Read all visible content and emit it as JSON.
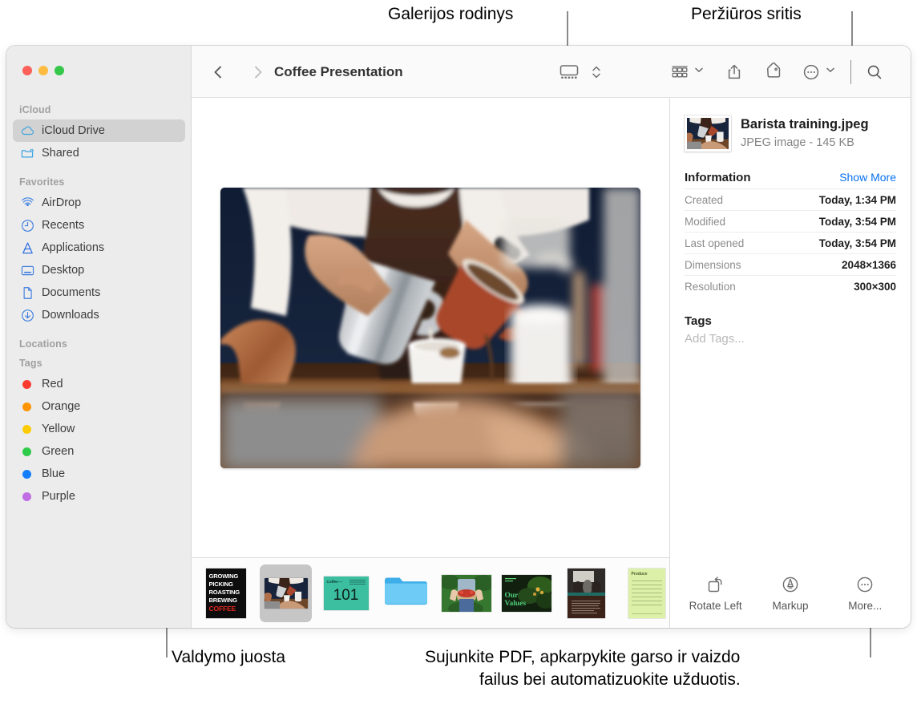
{
  "callouts": [
    {
      "id": "gallery-view",
      "text": "Galerijos rodinys"
    },
    {
      "id": "preview-pane",
      "text": "Peržiūros sritis"
    },
    {
      "id": "control-bar",
      "text": "Valdymo juosta"
    },
    {
      "id": "pdf-tasks-line1",
      "text": "Sujunkite PDF, apkarpykite garso ir vaizdo"
    },
    {
      "id": "pdf-tasks-line2",
      "text": "failus bei automatizuokite užduotis."
    }
  ],
  "window": {
    "traffic_lights": [
      {
        "name": "close",
        "color": "#fc6058"
      },
      {
        "name": "minimize",
        "color": "#fdbc40"
      },
      {
        "name": "zoom",
        "color": "#34c749"
      }
    ]
  },
  "sidebar": {
    "groups": [
      {
        "header": "iCloud",
        "items": [
          {
            "label": "iCloud Drive",
            "icon": "cloud-icon",
            "selected": true
          },
          {
            "label": "Shared",
            "icon": "shared-folder-icon",
            "selected": false
          }
        ]
      },
      {
        "header": "Favorites",
        "items": [
          {
            "label": "AirDrop",
            "icon": "airdrop-icon",
            "selected": false
          },
          {
            "label": "Recents",
            "icon": "clock-icon",
            "selected": false
          },
          {
            "label": "Applications",
            "icon": "applications-icon",
            "selected": false
          },
          {
            "label": "Desktop",
            "icon": "desktop-icon",
            "selected": false
          },
          {
            "label": "Documents",
            "icon": "document-icon",
            "selected": false
          },
          {
            "label": "Downloads",
            "icon": "downloads-icon",
            "selected": false
          }
        ]
      },
      {
        "header": "Locations",
        "items": []
      },
      {
        "header": "Tags",
        "items": [
          {
            "label": "Red",
            "icon": "tag-dot-icon",
            "color": "#fb3b30",
            "selected": false
          },
          {
            "label": "Orange",
            "icon": "tag-dot-icon",
            "color": "#fd9400",
            "selected": false
          },
          {
            "label": "Yellow",
            "icon": "tag-dot-icon",
            "color": "#fdcb01",
            "selected": false
          },
          {
            "label": "Green",
            "icon": "tag-dot-icon",
            "color": "#2ecc49",
            "selected": false
          },
          {
            "label": "Blue",
            "icon": "tag-dot-icon",
            "color": "#147efb",
            "selected": false
          },
          {
            "label": "Purple",
            "icon": "tag-dot-icon",
            "color": "#c06ee3",
            "selected": false
          }
        ]
      }
    ]
  },
  "toolbar": {
    "back_icon": "chevron-left-icon",
    "forward_icon": "chevron-right-icon",
    "title": "Coffee Presentation",
    "view_gallery_icon": "gallery-view-icon",
    "view_stepper_icon": "up-down-chevrons-icon",
    "group_icon": "group-by-icon",
    "group_chevron_icon": "chevron-down-icon",
    "share_icon": "share-icon",
    "tag_icon": "tag-icon",
    "more_icon": "ellipsis-circle-icon",
    "more_chevron_icon": "chevron-down-icon",
    "search_icon": "search-icon"
  },
  "gallery": {
    "hero_alt": "Barista pouring milk and coffee into a cup",
    "thumbnails": [
      {
        "name": "growing-picking-roasting-brewing-coffee-poster",
        "kind": "poster",
        "selected": false
      },
      {
        "name": "barista-training-photo",
        "kind": "photo",
        "selected": true
      },
      {
        "name": "coffee-101-slide",
        "kind": "slide",
        "selected": false
      },
      {
        "name": "blue-folder",
        "kind": "folder",
        "selected": false
      },
      {
        "name": "cherry-harvest-photo",
        "kind": "photo",
        "selected": false
      },
      {
        "name": "our-values-cover",
        "kind": "cover",
        "selected": false
      },
      {
        "name": "meeting-document",
        "kind": "document",
        "selected": false
      },
      {
        "name": "produce-invoice",
        "kind": "spreadsheet",
        "selected": false
      }
    ],
    "thumb_labels": {
      "poster_lines": [
        "GROWING",
        "PICKING",
        "ROASTING",
        "BREWING"
      ],
      "poster_accent_line": "COFFEE",
      "slide_title": "Coffee —",
      "slide_number": "101",
      "cover_title_line1": "Our",
      "cover_title_line2": "Values",
      "invoice_title": "Produce"
    }
  },
  "preview": {
    "file_name": "Barista training.jpeg",
    "file_kind": "JPEG image - 145 KB",
    "thumb_icon": "image-thumbnail",
    "information": {
      "title": "Information",
      "show_more": "Show More",
      "rows": [
        {
          "key": "Created",
          "value": "Today, 1:34 PM"
        },
        {
          "key": "Modified",
          "value": "Today, 3:54 PM"
        },
        {
          "key": "Last opened",
          "value": "Today, 3:54 PM"
        },
        {
          "key": "Dimensions",
          "value": "2048×1366"
        },
        {
          "key": "Resolution",
          "value": "300×300"
        }
      ]
    },
    "tags": {
      "title": "Tags",
      "placeholder": "Add Tags..."
    },
    "actions": [
      {
        "label": "Rotate Left",
        "icon": "rotate-left-icon"
      },
      {
        "label": "Markup",
        "icon": "markup-icon"
      },
      {
        "label": "More...",
        "icon": "ellipsis-circle-icon"
      }
    ]
  },
  "colors": {
    "accent_link": "#0a72f0",
    "sidebar_bg": "#ececec",
    "selected_row": "#d2d2d2",
    "toolbar_bg": "#fafafa"
  }
}
